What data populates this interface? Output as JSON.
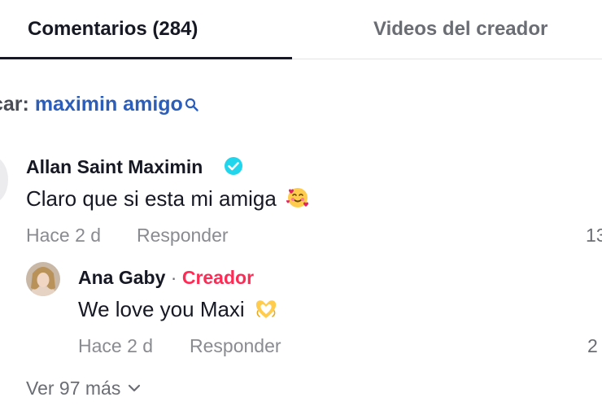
{
  "tabs": {
    "comments_label": "Comentarios (284)",
    "videos_label": "Videos del creador"
  },
  "search": {
    "label": "car: ",
    "term": "maximin amigo"
  },
  "comment": {
    "author": "Allan Saint Maximin",
    "verified_icon": "verified-check-icon",
    "text": "Claro que si esta mi amiga",
    "emoji": "smiling-face-with-hearts",
    "time": "Hace 2 d",
    "reply_label": "Responder",
    "likes": "13"
  },
  "reply": {
    "author": "Ana Gaby",
    "separator": " · ",
    "badge": "Creador",
    "text": "We love you Maxi",
    "emoji": "heart-hands",
    "time": "Hace 2 d",
    "reply_label": "Responder",
    "likes": "2"
  },
  "view_more": {
    "label": "Ver 97 más",
    "icon": "chevron-down-icon"
  },
  "colors": {
    "accent_blue": "#2b5db9",
    "creator_red": "#fe2c55",
    "verified": "#20d5ec",
    "muted_text": "#8a8b91"
  }
}
